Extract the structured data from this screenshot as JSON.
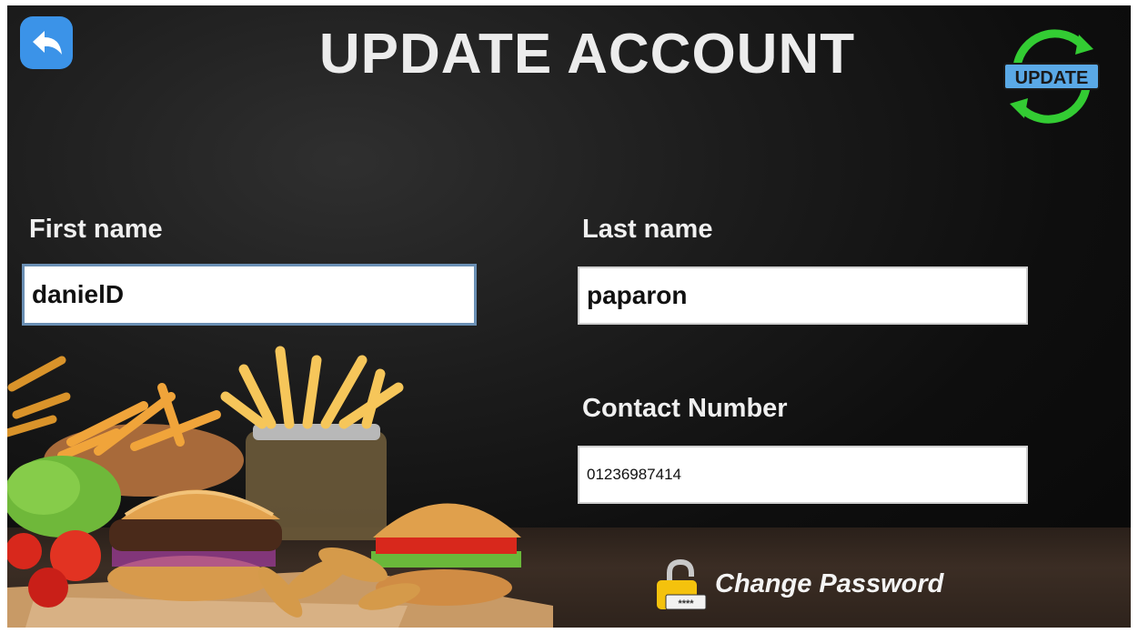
{
  "header": {
    "title": "UPDATE ACCOUNT",
    "back_icon": "back-arrow-icon"
  },
  "update_badge": {
    "text": "UPDATE",
    "icon": "refresh-cycle-icon"
  },
  "form": {
    "first_name": {
      "label": "First name",
      "value": "danielD"
    },
    "last_name": {
      "label": "Last name",
      "value": "paparon"
    },
    "contact_number": {
      "label": "Contact Number",
      "value": "01236987414"
    }
  },
  "change_password": {
    "label": "Change Password",
    "icon": "padlock-icon",
    "mask": "****"
  },
  "colors": {
    "accent_blue": "#3b93e8",
    "badge_green": "#33cc33",
    "badge_blue": "#5aa9e6"
  }
}
